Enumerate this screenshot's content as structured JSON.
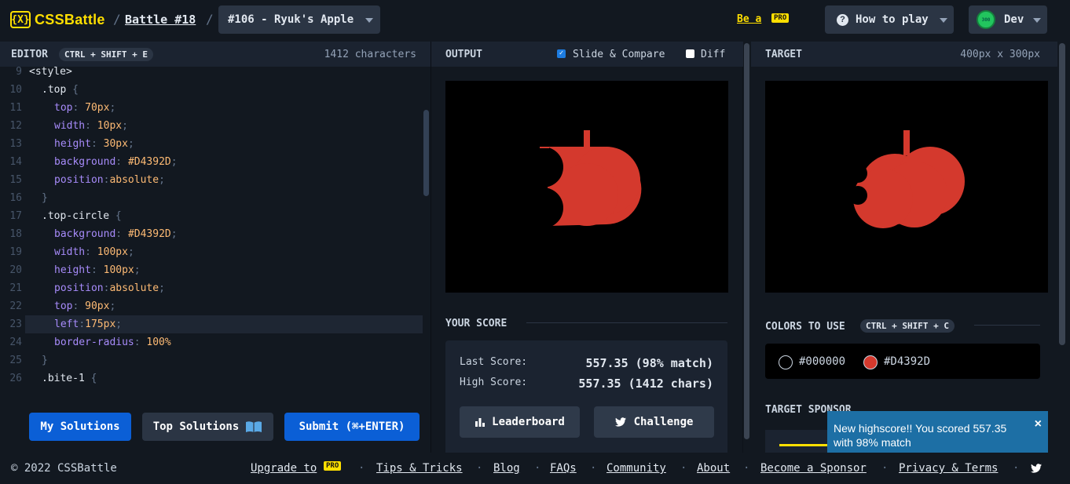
{
  "header": {
    "logo_mark": "{X}",
    "logo_text": "CSSBattle",
    "breadcrumb_sep": "/",
    "battle_label": "Battle #18",
    "target_select": "#106 - Ryuk's Apple",
    "be_a_label": "Be a",
    "pro_badge": "PRO",
    "how_to_play": "How to play",
    "user_name": "Dev",
    "avatar_text": "300"
  },
  "editor": {
    "title": "EDITOR",
    "shortcut": "CTRL + SHIFT + E",
    "char_count": "1412 characters",
    "lines": [
      {
        "n": "9",
        "code": "<style>"
      },
      {
        "n": "10",
        "sel": ".top",
        "brace": " {"
      },
      {
        "n": "11",
        "prop": "top",
        "val": "70px"
      },
      {
        "n": "12",
        "prop": "width",
        "val": "10px"
      },
      {
        "n": "13",
        "prop": "height",
        "val": "30px"
      },
      {
        "n": "14",
        "prop": "background",
        "val": "#D4392D"
      },
      {
        "n": "15",
        "prop": "position",
        "val": "absolute",
        "nospace": true
      },
      {
        "n": "16",
        "close": "}"
      },
      {
        "n": "17",
        "sel": ".top-circle",
        "brace": " {"
      },
      {
        "n": "18",
        "prop": "background",
        "val": "#D4392D"
      },
      {
        "n": "19",
        "prop": "width",
        "val": "100px"
      },
      {
        "n": "20",
        "prop": "height",
        "val": "100px"
      },
      {
        "n": "21",
        "prop": "position",
        "val": "absolute",
        "nospace": true
      },
      {
        "n": "22",
        "prop": "top",
        "val": "90px"
      },
      {
        "n": "23",
        "prop": "left",
        "val": "175px",
        "nospace": true,
        "highlight": true
      },
      {
        "n": "24",
        "prop": "border-radius",
        "val": "100%",
        "nosemi": true
      },
      {
        "n": "25",
        "close": "}"
      },
      {
        "n": "26",
        "sel": ".bite-1",
        "brace": " {"
      }
    ],
    "buttons": {
      "my_solutions": "My Solutions",
      "top_solutions": "Top Solutions",
      "submit": "Submit (⌘+ENTER)"
    }
  },
  "output": {
    "title": "OUTPUT",
    "slide_compare": "Slide & Compare",
    "slide_checked": true,
    "diff": "Diff",
    "diff_checked": false
  },
  "score": {
    "title": "YOUR SCORE",
    "last_label": "Last Score:",
    "last_value": "557.35 (98% match)",
    "high_label": "High Score:",
    "high_value": "557.35 (1412 chars)",
    "leaderboard": "Leaderboard",
    "challenge": "Challenge"
  },
  "target": {
    "title": "TARGET",
    "size": "400px x 300px",
    "colors_title": "COLORS TO USE",
    "colors_shortcut": "CTRL + SHIFT + C",
    "colors": [
      {
        "hex": "#000000",
        "label": "#000000"
      },
      {
        "hex": "#D4392D",
        "label": "#D4392D"
      }
    ],
    "sponsor_title": "TARGET SPONSOR"
  },
  "toast": {
    "message": "New highscore!! You scored 557.35 with 98% match",
    "close": "×",
    "progress": 0.2
  },
  "footer": {
    "copyright": "© 2022 CSSBattle",
    "upgrade_to": "Upgrade to",
    "pro_badge": "PRO",
    "links": [
      "Tips & Tricks",
      "Blog",
      "FAQs",
      "Community",
      "About",
      "Become a Sponsor",
      "Privacy & Terms"
    ],
    "separator": "·"
  },
  "colors": {
    "accent_yellow": "#ffdf00",
    "apple_red": "#D4392D",
    "button_blue": "#0b5fd6"
  }
}
